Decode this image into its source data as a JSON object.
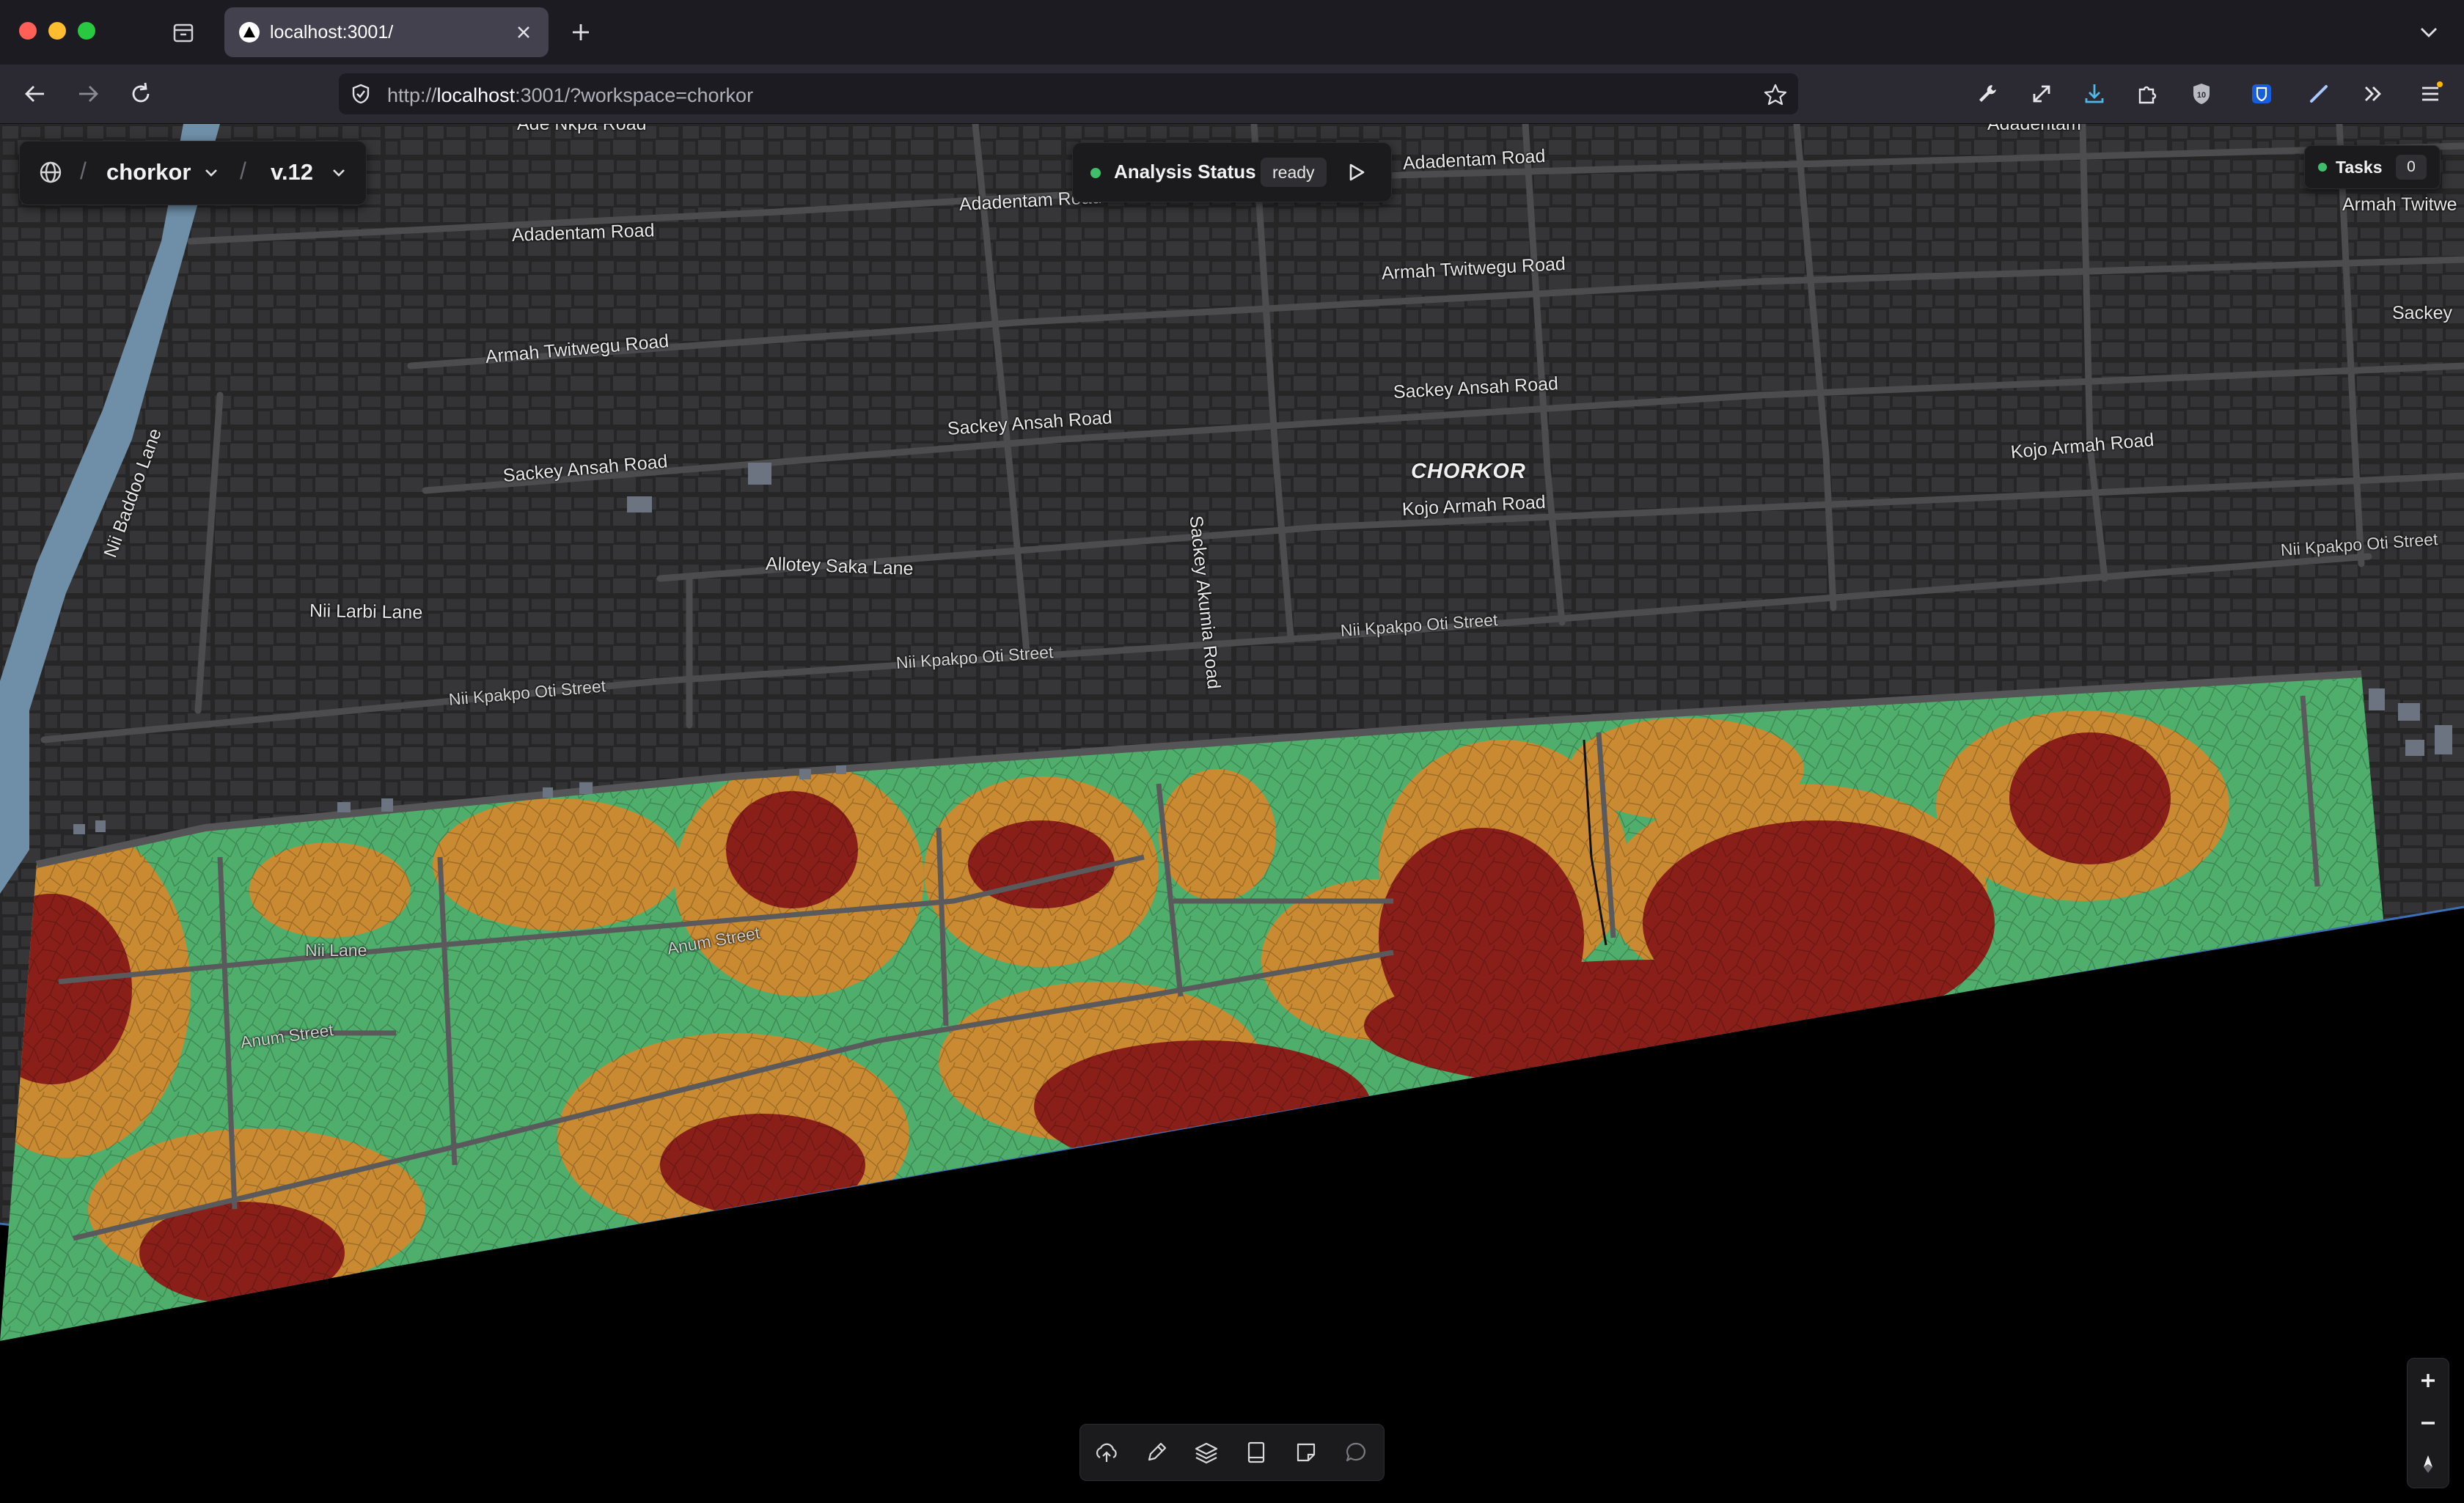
{
  "browser": {
    "tab_title": "localhost:3001/",
    "url_host": "localhost",
    "url_prefix": "http://",
    "url_suffix": ":3001/?workspace=chorkor"
  },
  "breadcrumb": {
    "workspace": "chorkor",
    "version": "v.12",
    "separator": "/"
  },
  "analysis": {
    "label": "Analysis Status",
    "state": "ready"
  },
  "tasks": {
    "label": "Tasks",
    "count": "0"
  },
  "map": {
    "place": "CHORKOR",
    "road_labels": [
      "Ade Nkpa Road",
      "Adadentam Road",
      "Adadentam Road",
      "Adadentam Road",
      "Adadentam",
      "Armah Twitwegu Road",
      "Armah Twitwegu Road",
      "Armah Twitwe",
      "Sackey Ansah Road",
      "Sackey Ansah Road",
      "Sackey Ansah Road",
      "Sackey",
      "Sackey Akumia Road",
      "Kojo Armah Road",
      "Kojo Armah Road",
      "Allotey Saka Lane",
      "Nii Larbi Lane",
      "Nii Baddoo Lane",
      "Nii Kpakpo Oti Street",
      "Nii Kpakpo Oti Street",
      "Nii Kpakpo Oti Street",
      "Nii Kpakpo Oti Street",
      "Nii Lane",
      "Anum Street",
      "Anum Street"
    ],
    "colors": {
      "low": "#4fae6c",
      "medium": "#c98a32",
      "high": "#8a1f1a",
      "water": "#6f8fa8",
      "land": "#2a2a2b",
      "building": "#3a3a3c",
      "road": "#4c4c4e"
    }
  },
  "toolbar": {
    "icons": [
      "upload-icon",
      "draw-icon",
      "layers-icon",
      "book-icon",
      "note-icon",
      "comment-icon"
    ]
  },
  "zoom": {
    "in": "+",
    "out": "−"
  }
}
